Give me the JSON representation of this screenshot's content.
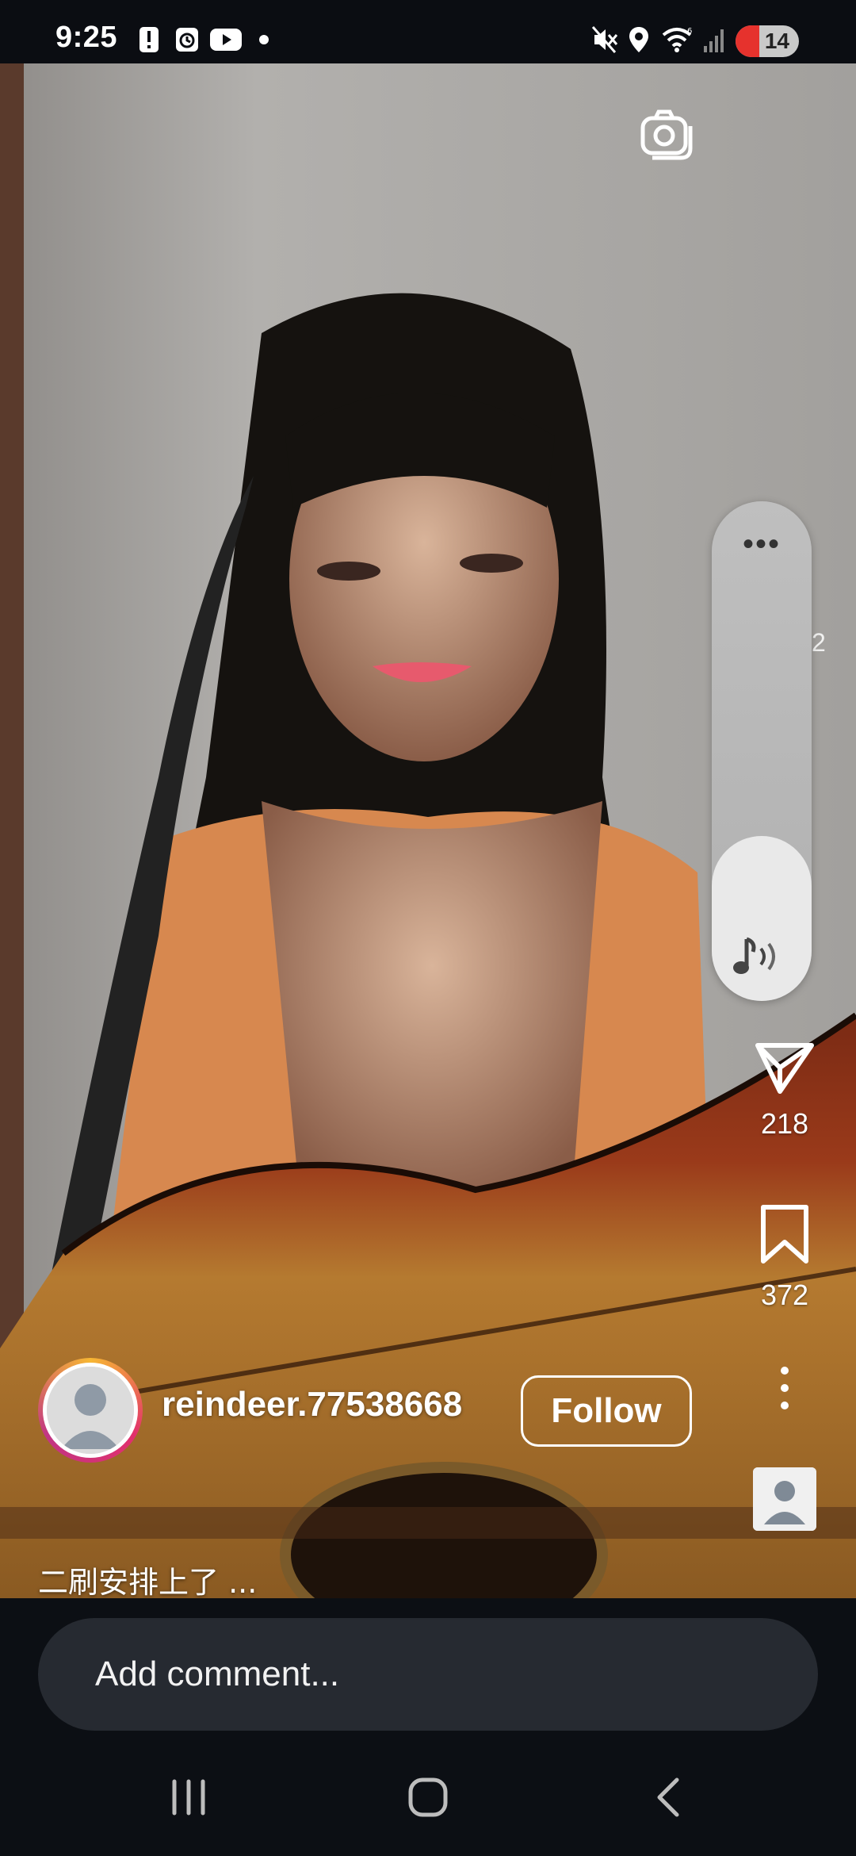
{
  "status_bar": {
    "time": "9:25",
    "battery_level": "14",
    "icons": [
      "alert-icon",
      "alarm-icon",
      "youtube-icon",
      "dot-icon",
      "mute-icon",
      "location-icon",
      "wifi-icon",
      "signal-icon",
      "battery-icon"
    ]
  },
  "video": {
    "camera_icon": "camera-icon",
    "volume": {
      "more_icon": "more-horizontal-icon",
      "level": 0.33,
      "note_icon": "music-note-icon"
    },
    "peek_number": "2"
  },
  "actions": {
    "share": {
      "icon": "send-icon",
      "count": "218"
    },
    "save": {
      "icon": "bookmark-icon",
      "count": "372"
    },
    "more_icon": "more-vertical-icon"
  },
  "author": {
    "username": "reindeer.77538668",
    "follow_label": "Follow"
  },
  "caption": "二刷安排上了 ...",
  "comment": {
    "placeholder": "Add comment..."
  },
  "nav": {
    "icons": [
      "recent-apps-icon",
      "home-icon",
      "back-icon"
    ]
  },
  "colors": {
    "accent_ring": [
      "#f7b733",
      "#e1306c",
      "#c13584"
    ],
    "background": "#0c0f14"
  }
}
